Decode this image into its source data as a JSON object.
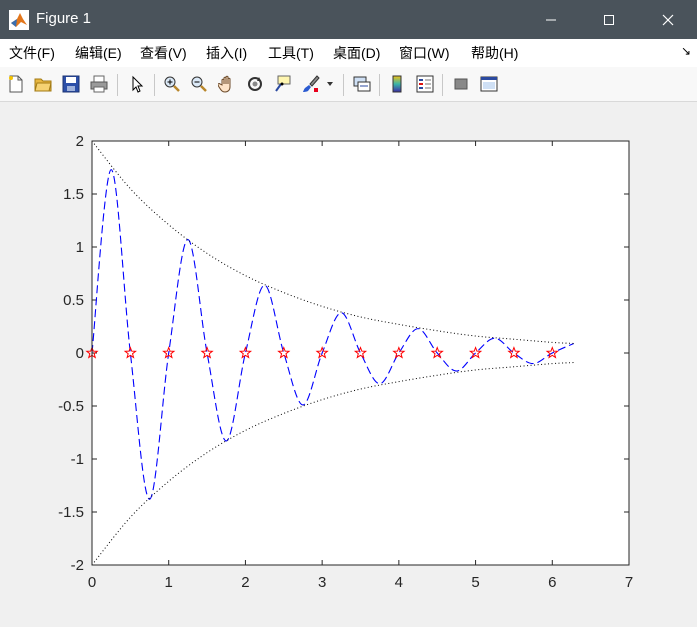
{
  "window": {
    "title": "Figure 1",
    "controls": [
      "minimize-icon",
      "maximize-icon",
      "close-icon"
    ]
  },
  "menu": {
    "items": [
      "文件(F)",
      "编辑(E)",
      "查看(V)",
      "插入(I)",
      "工具(T)",
      "桌面(D)",
      "窗口(W)",
      "帮助(H)"
    ]
  },
  "toolbar": {
    "buttons": [
      "new-figure-icon",
      "open-file-icon",
      "save-icon",
      "print-icon",
      "pointer-icon",
      "zoom-in-icon",
      "zoom-out-icon",
      "pan-hand-icon",
      "rotate-3d-icon",
      "data-cursor-icon",
      "brush-icon",
      "link-plot-icon",
      "colorbar-icon",
      "legend-icon",
      "hide-plot-tools-icon",
      "show-plot-tools-icon"
    ]
  },
  "colors": {
    "titlebar": "#4a535b",
    "series_damped": "#0000ff",
    "series_envelope": "#000000",
    "markers": "#ff0000"
  },
  "chart_data": {
    "type": "line",
    "xlim": [
      0,
      7
    ],
    "ylim": [
      -2,
      2
    ],
    "xticks": [
      0,
      1,
      2,
      3,
      4,
      5,
      6,
      7
    ],
    "yticks": [
      -2,
      -1.5,
      -1,
      -0.5,
      0,
      0.5,
      1,
      1.5,
      2
    ],
    "grid": false,
    "series": [
      {
        "style": "dashed blue line",
        "x": [
          0,
          0.25,
          0.5,
          0.75,
          1.0,
          1.25,
          1.5,
          1.75,
          2.0,
          2.25,
          2.5,
          2.75,
          3.0,
          3.25,
          3.5,
          3.75,
          4.0,
          4.25,
          4.5,
          4.75,
          5.0,
          5.25,
          5.5,
          5.75,
          6.0,
          6.28
        ],
        "y": [
          0,
          1.73,
          0,
          -1.38,
          0,
          1.07,
          0,
          -0.83,
          0,
          0.64,
          0,
          -0.49,
          0,
          0.38,
          0,
          -0.29,
          0,
          0.23,
          0,
          -0.17,
          0,
          0.14,
          0,
          -0.1,
          0,
          0.09
        ]
      },
      {
        "style": "dotted black upper envelope",
        "x": [
          0,
          0.5,
          1,
          1.5,
          2,
          2.5,
          3,
          3.5,
          4,
          4.5,
          5,
          5.5,
          6,
          6.28
        ],
        "y": [
          2.0,
          1.55,
          1.21,
          0.94,
          0.73,
          0.57,
          0.44,
          0.34,
          0.27,
          0.21,
          0.16,
          0.13,
          0.1,
          0.09
        ]
      },
      {
        "style": "dotted black lower envelope",
        "x": [
          0,
          0.5,
          1,
          1.5,
          2,
          2.5,
          3,
          3.5,
          4,
          4.5,
          5,
          5.5,
          6,
          6.28
        ],
        "y": [
          -2.0,
          -1.55,
          -1.21,
          -0.94,
          -0.73,
          -0.57,
          -0.44,
          -0.34,
          -0.27,
          -0.21,
          -0.16,
          -0.13,
          -0.1,
          -0.09
        ]
      },
      {
        "style": "red pentagram markers",
        "x": [
          0,
          0.5,
          1,
          1.5,
          2,
          2.5,
          3,
          3.5,
          4,
          4.5,
          5,
          5.5,
          6
        ],
        "y": [
          0,
          0,
          0,
          0,
          0,
          0,
          0,
          0,
          0,
          0,
          0,
          0,
          0
        ]
      }
    ]
  }
}
